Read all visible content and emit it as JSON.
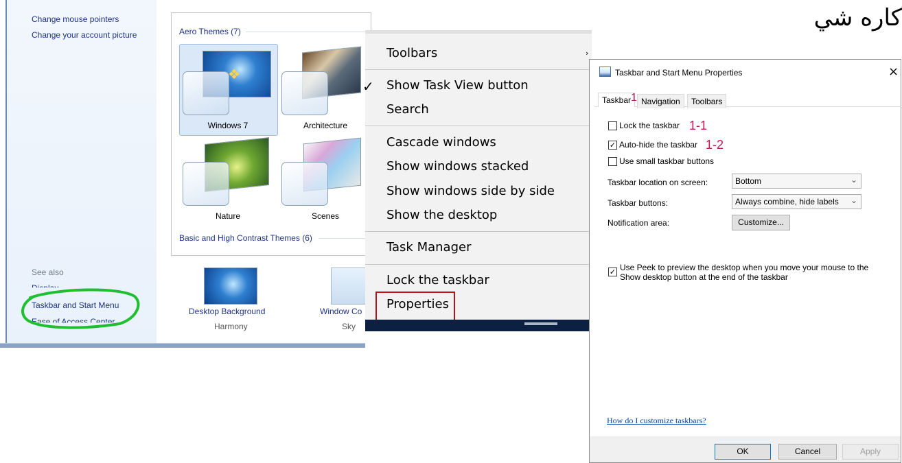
{
  "w7": {
    "links_top": [
      "Change mouse pointers",
      "Change your account picture"
    ],
    "see_also": "See also",
    "display": "Display",
    "taskbar_link": "Taskbar and Start Menu",
    "ease_link": "Ease of Access Center",
    "aero_header": "Aero Themes (7)",
    "basic_header": "Basic and High Contrast Themes (6)",
    "themes": [
      "Windows 7",
      "Architecture",
      "Nature",
      "Scenes"
    ],
    "desktop_background": "Desktop Background",
    "desktop_background_sub": "Harmony",
    "window_color": "Window Co",
    "window_color_sub": "Sky"
  },
  "context_menu": {
    "items": [
      "Toolbars",
      "Show Task View button",
      "Search",
      "Cascade windows",
      "Show windows stacked",
      "Show windows side by side",
      "Show the desktop",
      "Task Manager",
      "Lock the taskbar",
      "Properties"
    ],
    "checkmark": "✓"
  },
  "arabic_text": "كاره شي",
  "dialog": {
    "title": "Taskbar and Start Menu Properties",
    "close": "×",
    "tabs": [
      "Taskbar",
      "Navigation",
      "Toolbars"
    ],
    "tab_annotation": "1",
    "lock_taskbar": {
      "label": "Lock the taskbar",
      "checked": false,
      "annotation": "1-1"
    },
    "auto_hide": {
      "label": "Auto-hide the taskbar",
      "checked": true,
      "annotation": "1-2"
    },
    "small_buttons": {
      "label": "Use small taskbar buttons",
      "checked": false
    },
    "location_label": "Taskbar location on screen:",
    "location_value": "Bottom",
    "buttons_label": "Taskbar buttons:",
    "buttons_value": "Always combine, hide labels",
    "notification_label": "Notification area:",
    "customize_button": "Customize...",
    "peek": {
      "line1": "Use Peek to preview the desktop when you move your mouse to the",
      "line2": "Show desktop button at the end of the taskbar",
      "checked": true
    },
    "help_link": "How do I customize taskbars?",
    "ok": "OK",
    "cancel": "Cancel",
    "apply": "Apply"
  },
  "colors": {
    "annotation": "#c2185b",
    "highlight_box": "#b4141c",
    "green_marker": "#1fbf32",
    "link": "#1e3287"
  }
}
